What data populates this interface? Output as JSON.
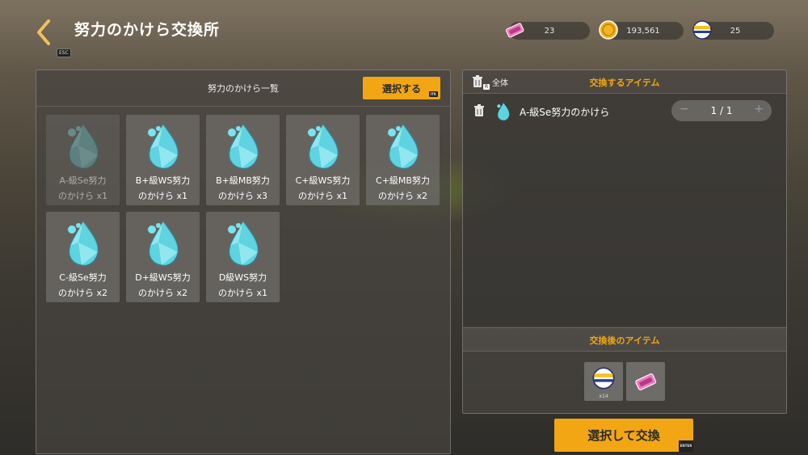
{
  "header": {
    "title": "努力のかけら交換所",
    "esc_key": "ESC"
  },
  "currencies": [
    {
      "name": "ticket",
      "icon": "pink-ticket-icon",
      "value": "23"
    },
    {
      "name": "coin",
      "icon": "gold-coin-icon",
      "value": "193,561"
    },
    {
      "name": "medal",
      "icon": "striped-medal-icon",
      "value": "25"
    }
  ],
  "left_panel": {
    "title": "努力のかけら一覧",
    "select_button": "選択する",
    "select_key": "ITK",
    "items": [
      {
        "line1": "A-級Se努力",
        "line2": "のかけら x1",
        "disabled": true
      },
      {
        "line1": "B+級WS努力",
        "line2": "のかけら x1",
        "disabled": false
      },
      {
        "line1": "B+級MB努力",
        "line2": "のかけら x3",
        "disabled": false
      },
      {
        "line1": "C+級WS努力",
        "line2": "のかけら x1",
        "disabled": false
      },
      {
        "line1": "C+級MB努力",
        "line2": "のかけら x2",
        "disabled": false
      },
      {
        "line1": "C-級Se努力",
        "line2": "のかけら x2",
        "disabled": false
      },
      {
        "line1": "D+級WS努力",
        "line2": "のかけら x2",
        "disabled": false
      },
      {
        "line1": "D級WS努力",
        "line2": "のかけら x1",
        "disabled": false
      }
    ]
  },
  "right_panel": {
    "all_label": "全体",
    "all_key": "R",
    "exchange_items_title": "交換するアイテム",
    "selected": [
      {
        "name": "A-級Se努力のかけら",
        "qty": "1 / 1"
      }
    ],
    "after_title": "交換後のアイテム",
    "rewards": [
      {
        "icon": "striped-medal-icon",
        "count": "x14"
      },
      {
        "icon": "pink-ticket-icon",
        "count": ""
      }
    ]
  },
  "exchange_button": "選択して交換",
  "exchange_key": "ENTER",
  "colors": {
    "accent": "#f2a614",
    "shard": "#5fd3e0"
  }
}
